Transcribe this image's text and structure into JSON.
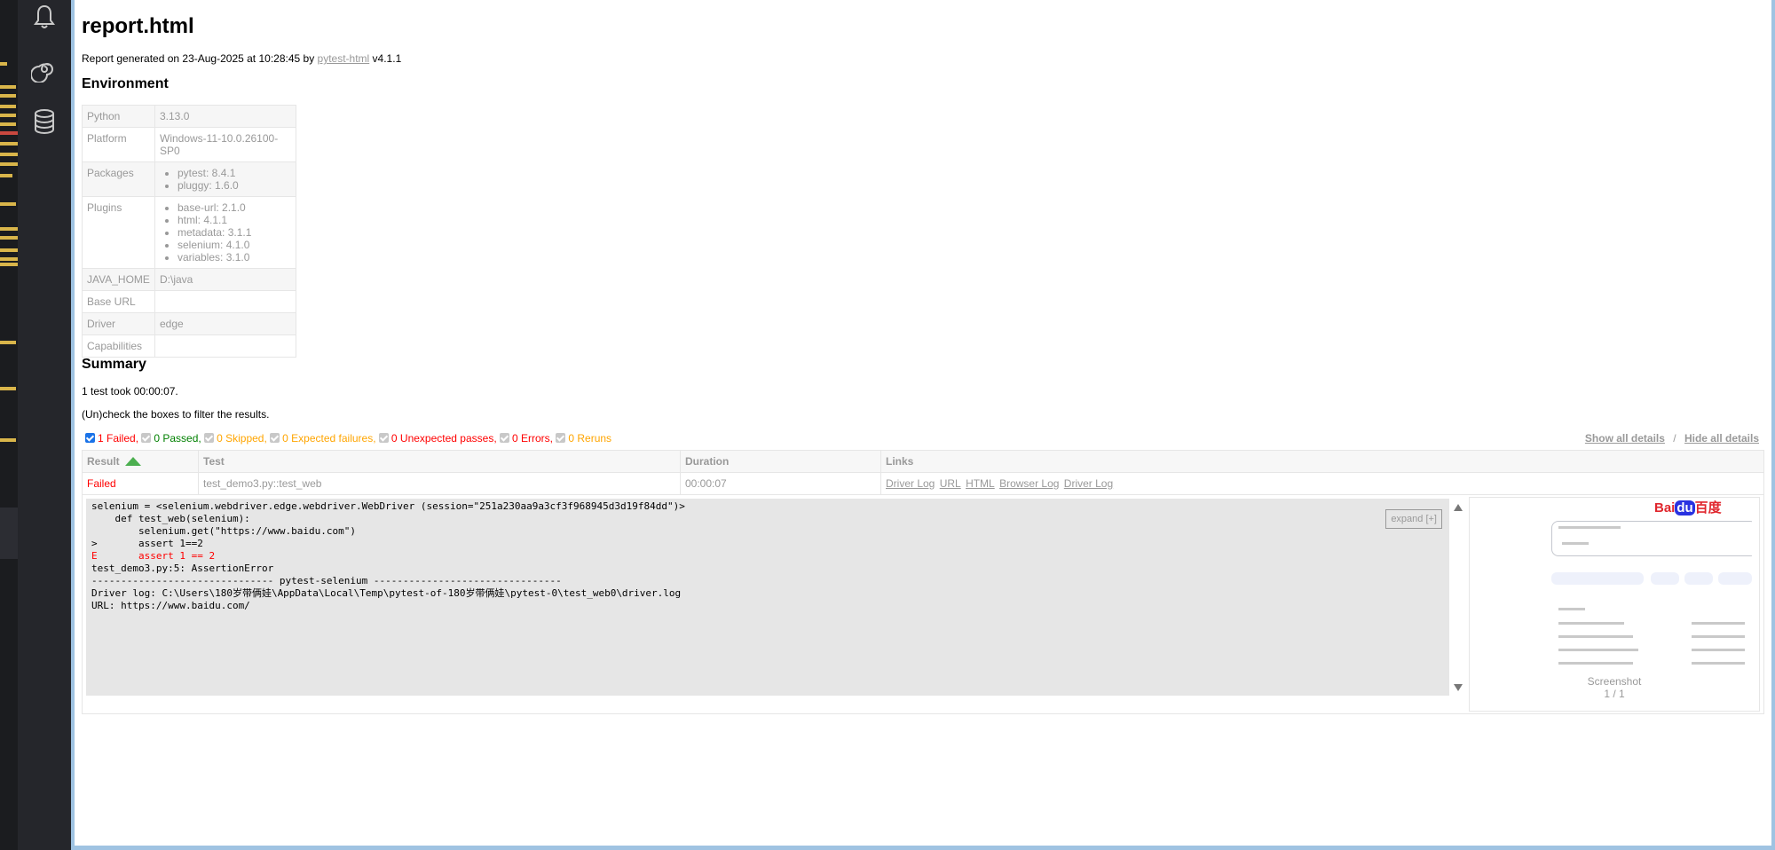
{
  "report": {
    "title": "report.html",
    "generated_prefix": "Report generated on 23-Aug-2025 at 10:28:45 by ",
    "generated_link": "pytest-html",
    "generated_suffix": " v4.1.1",
    "environment_title": "Environment",
    "environment": {
      "python_key": "Python",
      "python_val": "3.13.0",
      "platform_key": "Platform",
      "platform_val": "Windows-11-10.0.26100-SP0",
      "packages_key": "Packages",
      "packages": [
        "pytest: 8.4.1",
        "pluggy: 1.6.0"
      ],
      "plugins_key": "Plugins",
      "plugins": [
        "base-url: 2.1.0",
        "html: 4.1.1",
        "metadata: 3.1.1",
        "selenium: 4.1.0",
        "variables: 3.1.0"
      ],
      "java_key": "JAVA_HOME",
      "java_val": "D:\\java",
      "baseurl_key": "Base URL",
      "baseurl_val": "",
      "driver_key": "Driver",
      "driver_val": "edge",
      "caps_key": "Capabilities",
      "caps_val": ""
    },
    "summary_title": "Summary",
    "took": "1 test took 00:00:07.",
    "filter_hint": "(Un)check the boxes to filter the results.",
    "filters": {
      "failed": "1 Failed,",
      "passed": "0 Passed,",
      "skipped": "0 Skipped,",
      "xfailed": "0 Expected failures,",
      "xpassed": "0 Unexpected passes,",
      "errors": "0 Errors,",
      "reruns": "0 Reruns"
    },
    "show_all": "Show all details",
    "details_sep": "/",
    "hide_all": "Hide all details",
    "table": {
      "headers": [
        "Result",
        "Test",
        "Duration",
        "Links"
      ],
      "row": {
        "result": "Failed",
        "test": "test_demo3.py::test_web",
        "duration": "00:00:07",
        "links": [
          "Driver Log",
          "URL",
          "HTML",
          "Browser Log",
          "Driver Log"
        ]
      }
    },
    "log_lines": [
      "selenium = <selenium.webdriver.edge.webdriver.WebDriver (session=\"251a230aa9a3cf3f968945d3d19f84dd\")>",
      "",
      "    def test_web(selenium):",
      "        selenium.get(\"https://www.baidu.com\")",
      ">       assert 1==2",
      "E       assert 1 == 2",
      "",
      "test_demo3.py:5: AssertionError",
      "",
      "------------------------------- pytest-selenium --------------------------------",
      "Driver log: C:\\Users\\180岁带俩娃\\AppData\\Local\\Temp\\pytest-of-180岁带俩娃\\pytest-0\\test_web0\\driver.log",
      "URL: https://www.baidu.com/"
    ],
    "expand_label": "expand [+]",
    "screenshot_logo_a": "Bai",
    "screenshot_logo_b": "du",
    "screenshot_logo_c": "百度",
    "screenshot_caption": "Screenshot",
    "screenshot_count": "1 / 1"
  },
  "icons": [
    "bell-icon",
    "spiral-icon",
    "database-icon"
  ],
  "colors": {
    "failed": "#ff0000",
    "passed": "#008000",
    "warning": "#ffa500",
    "checkbox": "#1a73e8"
  }
}
